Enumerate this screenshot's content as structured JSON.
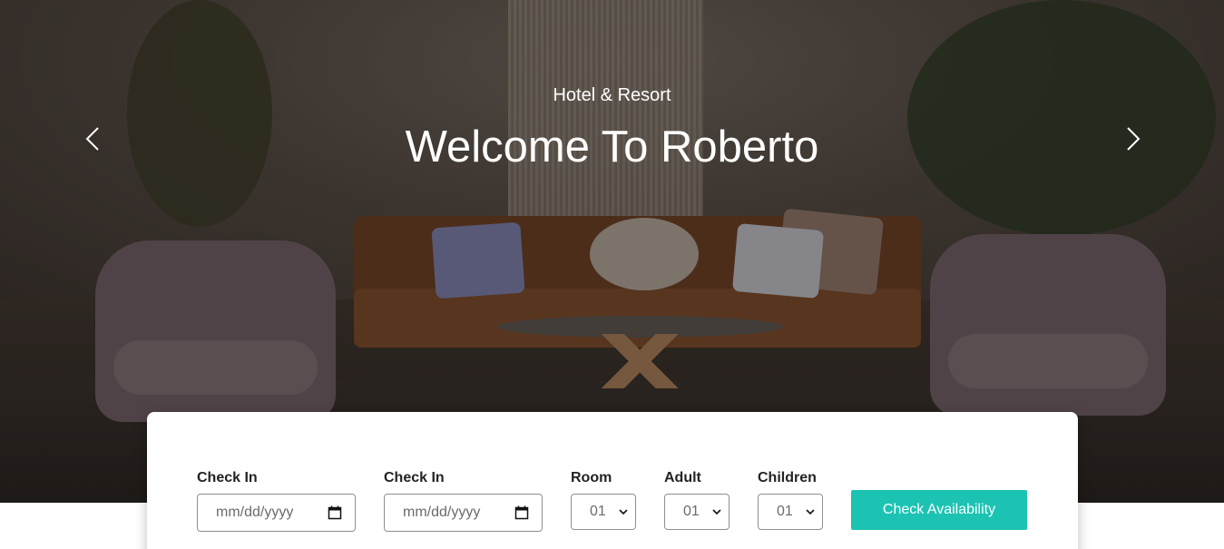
{
  "hero": {
    "subtitle": "Hotel & Resort",
    "title": "Welcome To Roberto",
    "prev_icon": "chevron-left-icon",
    "next_icon": "chevron-right-icon"
  },
  "booking": {
    "check_in_1": {
      "label": "Check In",
      "placeholder": "mm/dd/yyyy"
    },
    "check_in_2": {
      "label": "Check In",
      "placeholder": "mm/dd/yyyy"
    },
    "room": {
      "label": "Room",
      "value": "01"
    },
    "adult": {
      "label": "Adult",
      "value": "01"
    },
    "children": {
      "label": "Children",
      "value": "01"
    },
    "submit_label": "Check Availability",
    "accent_color": "#1cc3b2"
  }
}
